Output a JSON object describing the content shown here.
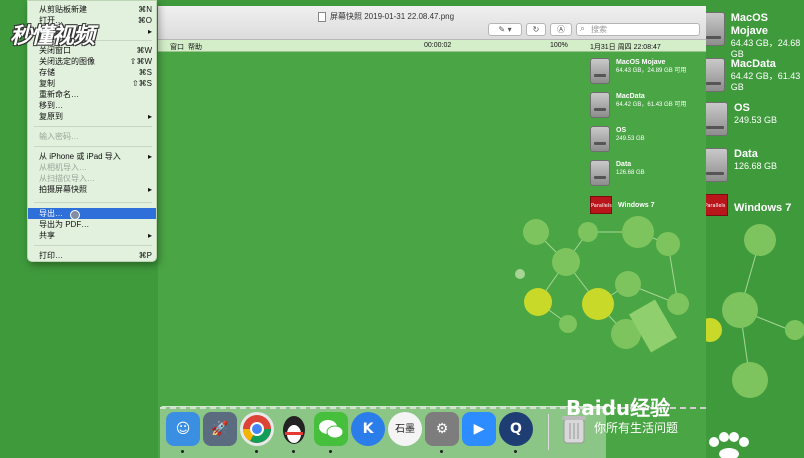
{
  "logo": {
    "text": "秒懂视频"
  },
  "window": {
    "title": "屏幕快照 2019-01-31 22.08.47.png",
    "search_placeholder": "搜索"
  },
  "inner_menubar": {
    "window_menu": "窗口",
    "help_menu": "帮助",
    "timer": "00:00:02",
    "battery": "100%",
    "clock": "1月31日 周四 22:08:47"
  },
  "file_menu": {
    "items": [
      {
        "label": "从剪贴板新建",
        "shortcut": "⌘N",
        "enabled": true
      },
      {
        "label": "打开…",
        "shortcut": "⌘O",
        "enabled": true
      },
      {
        "label": "打开最近使用",
        "shortcut": "▸",
        "enabled": true
      },
      {
        "label": "关闭窗口",
        "shortcut": "⌘W",
        "enabled": true
      },
      {
        "label": "关闭选定的图像",
        "shortcut": "⇧⌘W",
        "enabled": true
      },
      {
        "label": "存储",
        "shortcut": "⌘S",
        "enabled": true
      },
      {
        "label": "复制",
        "shortcut": "⇧⌘S",
        "enabled": true
      },
      {
        "label": "重新命名…",
        "shortcut": "",
        "enabled": true
      },
      {
        "label": "移到…",
        "shortcut": "",
        "enabled": true
      },
      {
        "label": "复原到",
        "shortcut": "▸",
        "enabled": true
      },
      {
        "label": "输入密码…",
        "shortcut": "",
        "enabled": false
      },
      {
        "label": "从 iPhone 或 iPad 导入",
        "shortcut": "▸",
        "enabled": true
      },
      {
        "label": "从相机导入…",
        "shortcut": "",
        "enabled": false
      },
      {
        "label": "从扫描仪导入…",
        "shortcut": "",
        "enabled": false
      },
      {
        "label": "拍摄屏幕快照",
        "shortcut": "▸",
        "enabled": true
      },
      {
        "label": "导出…",
        "shortcut": "",
        "enabled": true,
        "selected": true
      },
      {
        "label": "导出为 PDF…",
        "shortcut": "",
        "enabled": true
      },
      {
        "label": "共享",
        "shortcut": "▸",
        "enabled": true
      },
      {
        "label": "打印…",
        "shortcut": "⌘P",
        "enabled": true
      }
    ]
  },
  "inner_desktop": [
    {
      "name": "MacOS Mojave",
      "info": "64.43 GB，24.89 GB 可用"
    },
    {
      "name": "MacData",
      "info": "64.42 GB，61.43 GB 可用"
    },
    {
      "name": "OS",
      "info": "249.53 GB"
    },
    {
      "name": "Data",
      "info": "126.68 GB"
    },
    {
      "name": "Windows 7",
      "info": "",
      "tile": "Parallels"
    }
  ],
  "outer_desktop": [
    {
      "name": "MacOS Mojave",
      "info": "64.43 GB，24.68 GB"
    },
    {
      "name": "MacData",
      "info": "64.42 GB，61.43 GB"
    },
    {
      "name": "OS",
      "info": "249.53 GB"
    },
    {
      "name": "Data",
      "info": "126.68 GB"
    },
    {
      "name": "Windows 7",
      "info": "",
      "tile": "Parallels"
    }
  ],
  "dock": [
    {
      "name": "finder",
      "color": "#3b8fe3"
    },
    {
      "name": "launchpad",
      "color": "#5b6b80"
    },
    {
      "name": "chrome",
      "color": "#e8e8e8"
    },
    {
      "name": "qq",
      "color": "#222222"
    },
    {
      "name": "wechat",
      "color": "#46c03c"
    },
    {
      "name": "kuaiya",
      "color": "#2b7de9"
    },
    {
      "name": "shimo",
      "color": "#f4f4f4",
      "text": "石墨"
    },
    {
      "name": "system-preferences",
      "color": "#7d7d7d"
    },
    {
      "name": "zoom",
      "color": "#2d8cff"
    },
    {
      "name": "quicktime",
      "color": "#1e3d73"
    },
    {
      "name": "trash",
      "color": "#d8d8d8"
    }
  ],
  "watermark": {
    "brand": "Baidu经验",
    "slogan": "你所有生活问题"
  }
}
